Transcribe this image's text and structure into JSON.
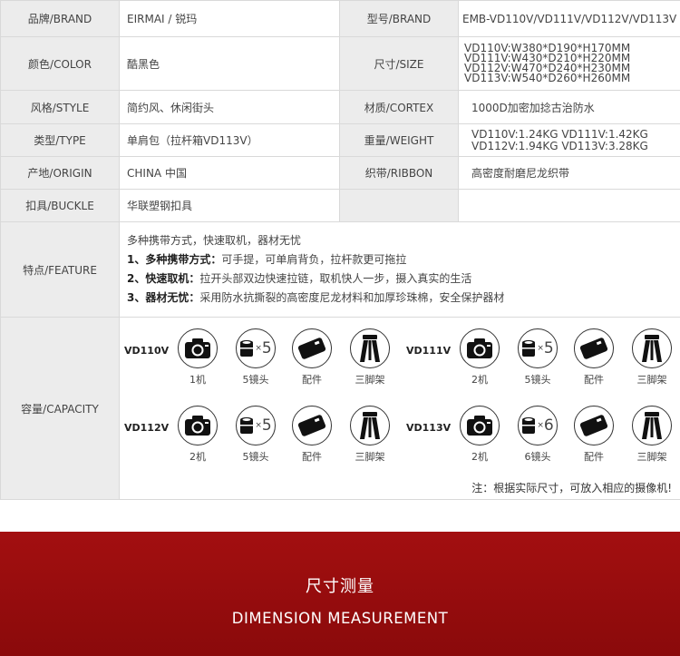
{
  "spec": {
    "brand_label": "品牌/BRAND",
    "brand_value": "EIRMAI / 锐玛",
    "model_label": "型号/BRAND",
    "model_value": "EMB-VD110V/VD111V/VD112V/VD113V",
    "color_label": "颜色/COLOR",
    "color_value": "酷黑色",
    "size_label": "尺寸/SIZE",
    "size_lines": [
      "VD110V:W380*D190*H170MM",
      "VD111V:W430*D210*H220MM",
      "VD112V:W470*D240*H230MM",
      "VD113V:W540*D260*H260MM"
    ],
    "style_label": "风格/STYLE",
    "style_value": "简约风、休闲街头",
    "material_label": "材质/CORTEX",
    "material_value": "1000D加密加捻古治防水",
    "type_label": "类型/TYPE",
    "type_value": "单肩包（拉杆箱VD113V）",
    "weight_label": "重量/WEIGHT",
    "weight_lines": [
      "VD110V:1.24KG  VD111V:1.42KG",
      "VD112V:1.94KG  VD113V:3.28KG"
    ],
    "origin_label": "产地/ORIGIN",
    "origin_value": "CHINA 中国",
    "ribbon_label": "织带/RIBBON",
    "ribbon_value": "高密度耐磨尼龙织带",
    "buckle_label": "扣具/BUCKLE",
    "buckle_value": "华联塑钢扣具"
  },
  "feature": {
    "label": "特点/FEATURE",
    "intro": "多种携带方式，快速取机，器材无忧",
    "points": [
      {
        "title": "1、多种携带方式：",
        "text": "可手提，可单肩背负，拉杆款更可拖拉"
      },
      {
        "title": "2、快速取机：",
        "text": "拉开头部双边快速拉链，取机快人一步，摄入真实的生活"
      },
      {
        "title": "3、器材无忧：",
        "text": "采用防水抗撕裂的高密度尼龙材料和加厚珍珠棉，安全保护器材"
      }
    ]
  },
  "capacity": {
    "label": "容量/CAPACITY",
    "groups": [
      {
        "model": "VD110V",
        "camera": "1机",
        "lens_count": "5",
        "lens": "5镜头",
        "accessory": "配件",
        "tripod": "三脚架"
      },
      {
        "model": "VD111V",
        "camera": "2机",
        "lens_count": "5",
        "lens": "5镜头",
        "accessory": "配件",
        "tripod": "三脚架"
      },
      {
        "model": "VD112V",
        "camera": "2机",
        "lens_count": "5",
        "lens": "5镜头",
        "accessory": "配件",
        "tripod": "三脚架"
      },
      {
        "model": "VD113V",
        "camera": "2机",
        "lens_count": "6",
        "lens": "6镜头",
        "accessory": "配件",
        "tripod": "三脚架"
      }
    ],
    "note": "注：根据实际尺寸，可放入相应的摄像机!"
  },
  "banner": {
    "title_cn": "尺寸测量",
    "title_en": "DIMENSION MEASUREMENT"
  },
  "colors": {
    "banner": "#9b0e0f",
    "label_bg": "#ececec",
    "border": "#d9d9d9"
  }
}
